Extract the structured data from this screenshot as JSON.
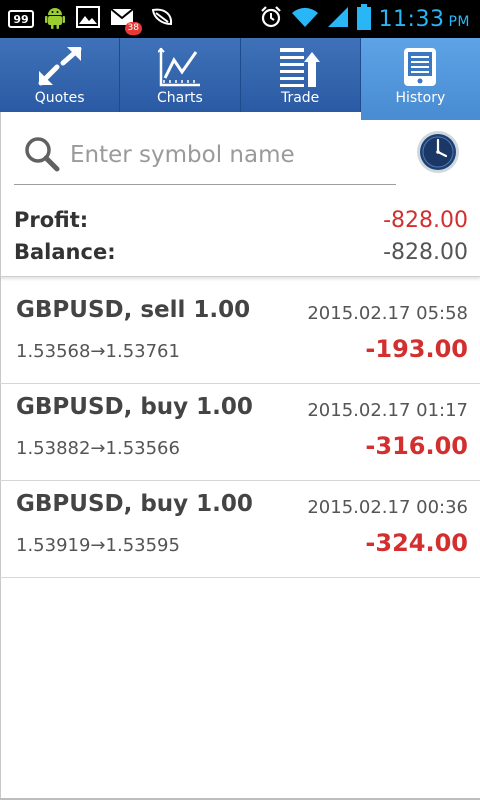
{
  "status_bar": {
    "battery_badge_text": "99",
    "mail_badge_count": "38",
    "time": "11:33",
    "ampm": "PM",
    "time_color": "#29b6f6"
  },
  "tabs": [
    {
      "label": "Quotes",
      "icon": "quotes-arrows-icon"
    },
    {
      "label": "Charts",
      "icon": "chart-line-icon"
    },
    {
      "label": "Trade",
      "icon": "trade-list-icon"
    },
    {
      "label": "History",
      "icon": "history-tablet-icon",
      "active": true
    }
  ],
  "search": {
    "placeholder": "Enter symbol name"
  },
  "summary": {
    "profit_label": "Profit:",
    "profit_value": "-828.00",
    "balance_label": "Balance:",
    "balance_value": "-828.00"
  },
  "trades": [
    {
      "title": "GBPUSD, sell 1.00",
      "time": "2015.02.17 05:58",
      "prices": "1.53568→1.53761",
      "amount": "-193.00"
    },
    {
      "title": "GBPUSD, buy 1.00",
      "time": "2015.02.17 01:17",
      "prices": "1.53882→1.53566",
      "amount": "-316.00"
    },
    {
      "title": "GBPUSD, buy 1.00",
      "time": "2015.02.17 00:36",
      "prices": "1.53919→1.53595",
      "amount": "-324.00"
    }
  ],
  "colors": {
    "tab_bar": "#2a5aa4",
    "active_tab": "#4a8dd3",
    "loss_red": "#d32f2f"
  }
}
